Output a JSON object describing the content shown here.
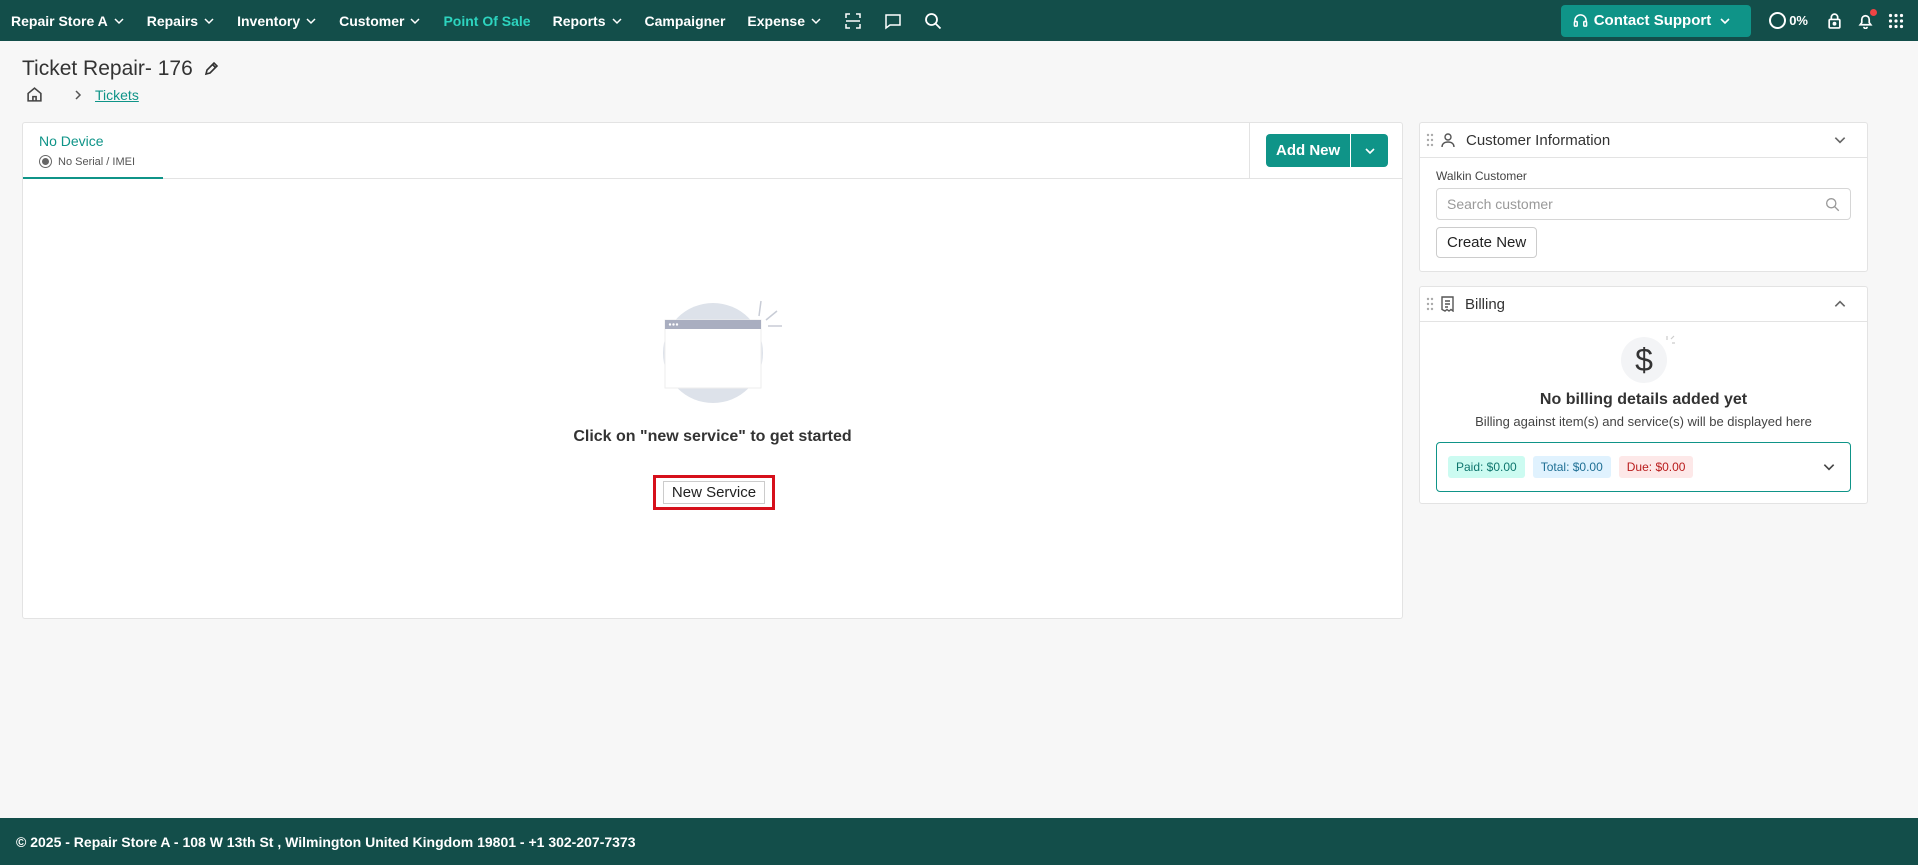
{
  "nav": {
    "store": "Repair Store A",
    "items": [
      {
        "label": "Repairs",
        "has_dropdown": true
      },
      {
        "label": "Inventory",
        "has_dropdown": true
      },
      {
        "label": "Customer",
        "has_dropdown": true
      },
      {
        "label": "Point Of Sale",
        "has_dropdown": false,
        "active": true
      },
      {
        "label": "Reports",
        "has_dropdown": true
      },
      {
        "label": "Campaigner",
        "has_dropdown": false
      },
      {
        "label": "Expense",
        "has_dropdown": true
      }
    ],
    "icons": [
      "scan-icon",
      "message-icon",
      "search-icon"
    ],
    "support_label": "Contact Support",
    "progress_text": "0%",
    "right_icons": [
      "lock-icon",
      "bell-icon",
      "apps-grid-icon"
    ]
  },
  "header": {
    "title": "Ticket Repair- 176",
    "breadcrumb_link": "Tickets"
  },
  "device_tab": {
    "name": "No Device",
    "serial": "No Serial / IMEI"
  },
  "main": {
    "add_new_label": "Add New",
    "empty_text": "Click on \"new service\" to get started",
    "new_service_label": "New Service"
  },
  "customer_info": {
    "title": "Customer Information",
    "customer_label": "Walkin Customer",
    "search_placeholder": "Search customer",
    "create_label": "Create New"
  },
  "billing": {
    "title": "Billing",
    "empty_title": "No billing details added yet",
    "empty_sub": "Billing against item(s) and service(s) will be displayed here",
    "paid": "Paid: $0.00",
    "total": "Total: $0.00",
    "due": "Due: $0.00"
  },
  "footer": {
    "text": "© 2025 - Repair Store A - 108 W 13th St , Wilmington United Kingdom 19801 - +1 302-207-7373"
  },
  "colors": {
    "brand_dark": "#134e4a",
    "accent": "#0f9488",
    "active_nav": "#2dd4bf",
    "highlight_border": "#d6101b"
  }
}
